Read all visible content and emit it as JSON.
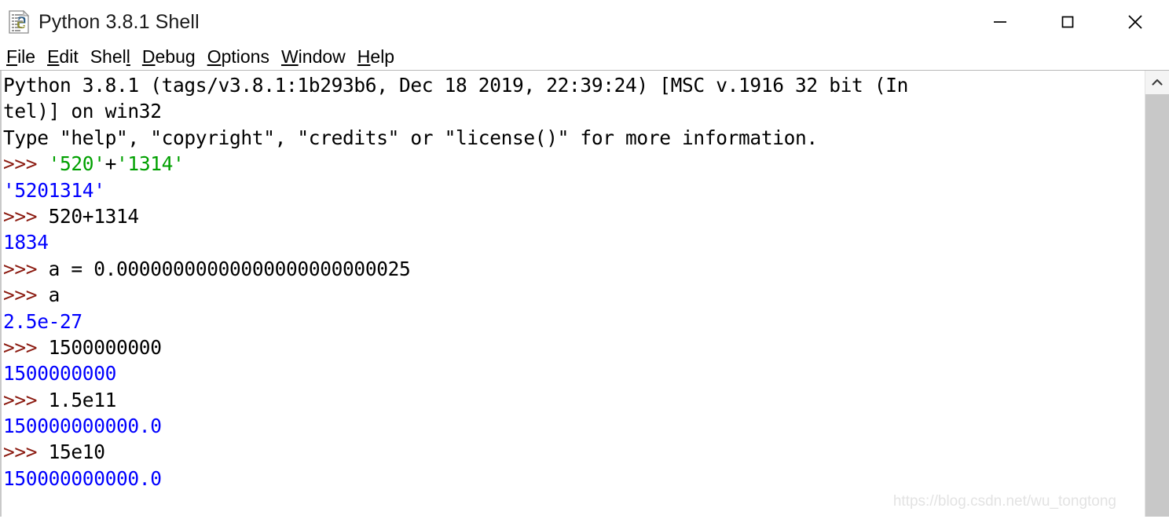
{
  "window": {
    "title": "Python 3.8.1 Shell",
    "icon": "python-document-icon",
    "controls": {
      "minimize": "minimize-icon",
      "maximize": "maximize-icon",
      "close": "close-icon"
    }
  },
  "menubar": {
    "items": [
      {
        "label": "File",
        "mnemonic_index": 0
      },
      {
        "label": "Edit",
        "mnemonic_index": 0
      },
      {
        "label": "Shell",
        "mnemonic_index": 4
      },
      {
        "label": "Debug",
        "mnemonic_index": 0
      },
      {
        "label": "Options",
        "mnemonic_index": 0
      },
      {
        "label": "Window",
        "mnemonic_index": 0
      },
      {
        "label": "Help",
        "mnemonic_index": 0
      }
    ]
  },
  "console": {
    "lines": [
      {
        "segments": [
          {
            "text": "Python 3.8.1 (tags/v3.8.1:1b293b6, Dec 18 2019, 22:39:24) [MSC v.1916 32 bit (In",
            "color": "black"
          }
        ]
      },
      {
        "segments": [
          {
            "text": "tel)] on win32",
            "color": "black"
          }
        ]
      },
      {
        "segments": [
          {
            "text": "Type \"help\", \"copyright\", \"credits\" or \"license()\" for more information.",
            "color": "black"
          }
        ]
      },
      {
        "segments": [
          {
            "text": ">>> ",
            "color": "prompt"
          },
          {
            "text": "'520'",
            "color": "string"
          },
          {
            "text": "+",
            "color": "black"
          },
          {
            "text": "'1314'",
            "color": "string"
          }
        ]
      },
      {
        "segments": [
          {
            "text": "'5201314'",
            "color": "out"
          }
        ]
      },
      {
        "segments": [
          {
            "text": ">>> ",
            "color": "prompt"
          },
          {
            "text": "520+1314",
            "color": "black"
          }
        ]
      },
      {
        "segments": [
          {
            "text": "1834",
            "color": "out"
          }
        ]
      },
      {
        "segments": [
          {
            "text": ">>> ",
            "color": "prompt"
          },
          {
            "text": "a = 0.00000000000000000000000025",
            "color": "black"
          }
        ]
      },
      {
        "segments": [
          {
            "text": ">>> ",
            "color": "prompt"
          },
          {
            "text": "a",
            "color": "black"
          }
        ]
      },
      {
        "segments": [
          {
            "text": "2.5e-27",
            "color": "out"
          }
        ]
      },
      {
        "segments": [
          {
            "text": ">>> ",
            "color": "prompt"
          },
          {
            "text": "1500000000",
            "color": "black"
          }
        ]
      },
      {
        "segments": [
          {
            "text": "1500000000",
            "color": "out"
          }
        ]
      },
      {
        "segments": [
          {
            "text": ">>> ",
            "color": "prompt"
          },
          {
            "text": "1.5e11",
            "color": "black"
          }
        ]
      },
      {
        "segments": [
          {
            "text": "150000000000.0",
            "color": "out"
          }
        ]
      },
      {
        "segments": [
          {
            "text": ">>> ",
            "color": "prompt"
          },
          {
            "text": "15e10",
            "color": "black"
          }
        ]
      },
      {
        "segments": [
          {
            "text": "150000000000.0",
            "color": "out"
          }
        ]
      }
    ]
  },
  "scrollbar": {
    "up_arrow": "chevron-up-icon",
    "position": "top"
  },
  "watermark": {
    "text": "https://blog.csdn.net/wu_tongtong"
  },
  "colors": {
    "prompt": "#8b1a10",
    "string": "#00a000",
    "output": "#0000ff",
    "text": "#000000",
    "background": "#ffffff",
    "scrollbar_track": "#c8c8c8",
    "watermark": "#e3e3e3"
  }
}
